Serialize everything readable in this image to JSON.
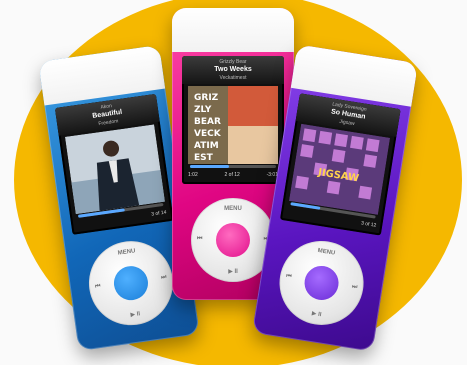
{
  "ipods": [
    {
      "color": "#1a7ed8",
      "status": {
        "artist": "Akon",
        "song": "Beautiful",
        "album": "Freedom"
      },
      "progress": 0.55,
      "times": {
        "left": "",
        "right": "3 of 14"
      },
      "wheel": {
        "menu": "MENU",
        "prev": "⏮",
        "next": "⏭",
        "play": "▶ II"
      }
    },
    {
      "color": "#e2108c",
      "status": {
        "artist": "Grizzly Bear",
        "song": "Two Weeks",
        "album": "Veckatimest"
      },
      "progress": 0.45,
      "times": {
        "left": "1:02",
        "right": "-3:01",
        "center": "2 of 12"
      },
      "wheel": {
        "menu": "MENU",
        "prev": "⏮",
        "next": "⏭",
        "play": "▶ II"
      }
    },
    {
      "color": "#6a2bd6",
      "status": {
        "artist": "Lady Sovereign",
        "song": "So Human",
        "album": "Jigsaw"
      },
      "progress": 0.35,
      "times": {
        "left": "",
        "right": "3 of 12"
      },
      "wheel": {
        "menu": "MENU",
        "prev": "⏮",
        "next": "⏭",
        "play": "▶ II"
      }
    }
  ],
  "album_art_text": {
    "grizzly": [
      "GRIZ",
      "ZLY",
      "BEAR",
      "VECK",
      "ATIM",
      "EST"
    ],
    "jigsaw": "JIGSAW"
  },
  "background_accent": "#f5b800"
}
